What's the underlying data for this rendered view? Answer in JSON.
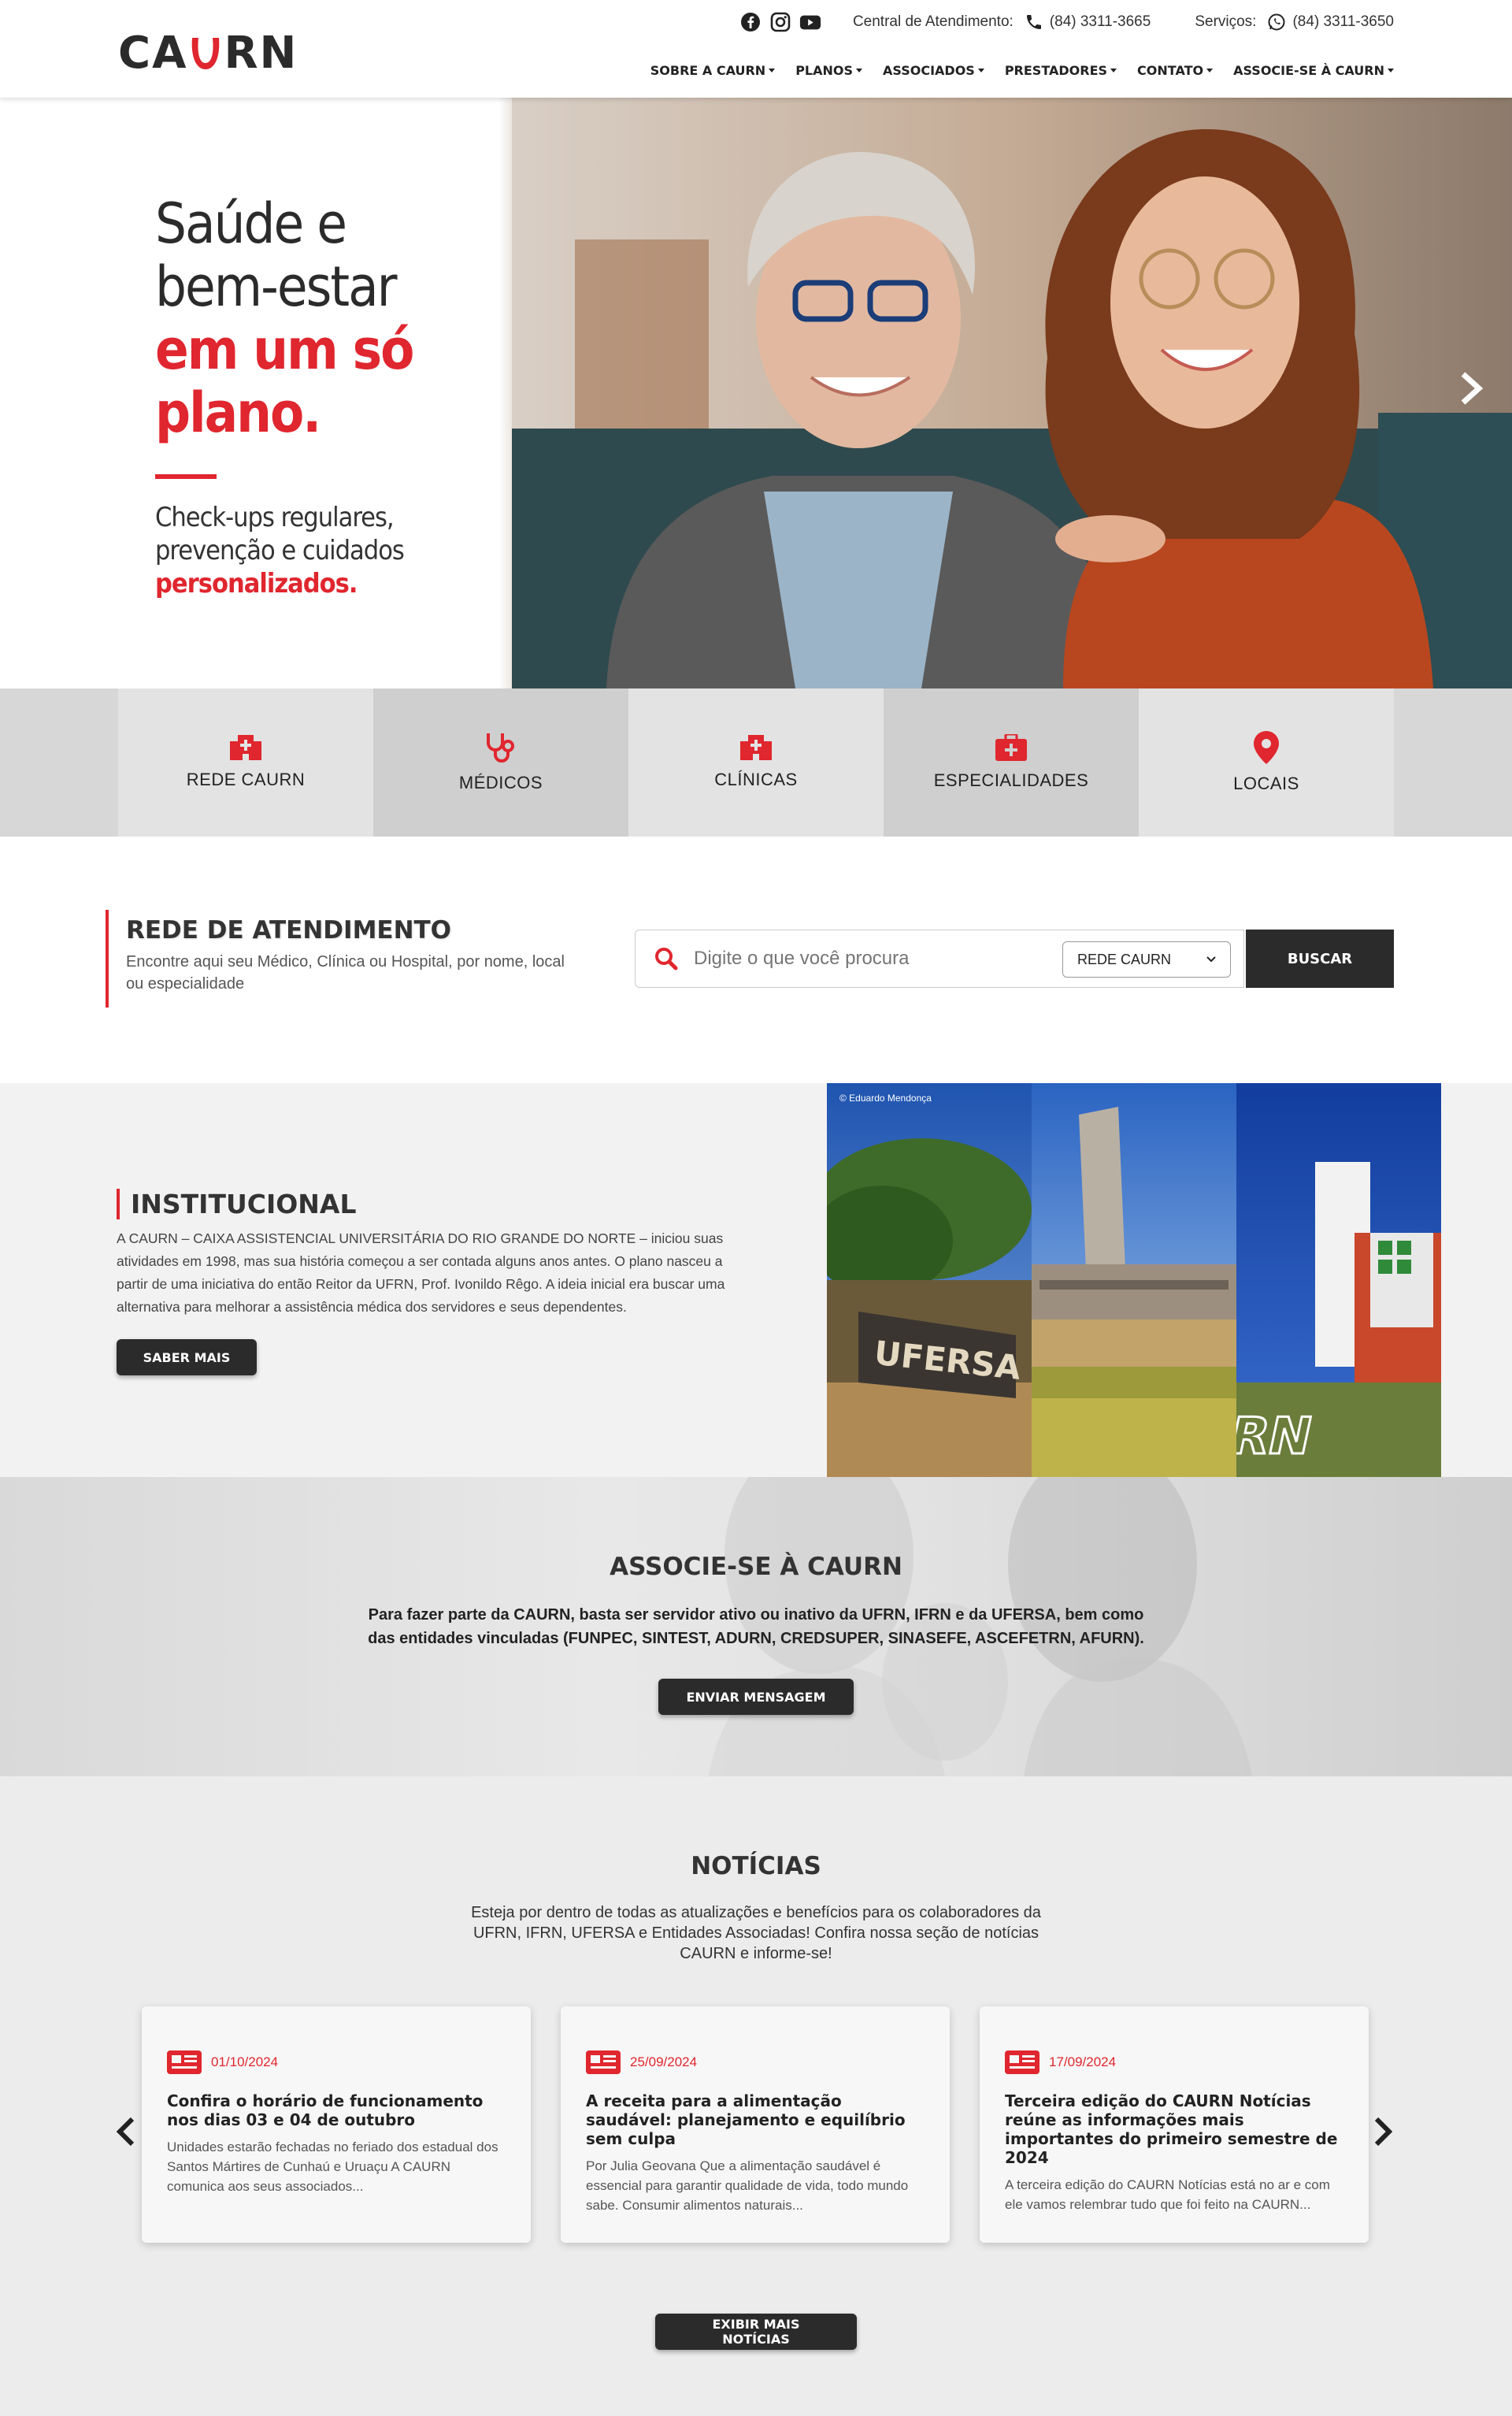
{
  "header": {
    "logo": "CAURN",
    "central_label": "Central de Atendimento:",
    "central_phone": "(84) 3311-3665",
    "servicos_label": "Serviços:",
    "servicos_phone": "(84) 3311-3650",
    "social": [
      "facebook-icon",
      "instagram-icon",
      "youtube-icon"
    ],
    "nav": [
      "SOBRE A CAURN",
      "PLANOS",
      "ASSOCIADOS",
      "PRESTADORES",
      "CONTATO",
      "ASSOCIE-SE À CAURN"
    ]
  },
  "hero": {
    "line1": "Saúde e",
    "line2": "bem-estar",
    "line3": "em um só",
    "line4": "plano.",
    "sub1": "Check-ups regulares,",
    "sub2": "prevenção e cuidados",
    "sub3": "personalizados.",
    "next_icon": "chevron-right-icon"
  },
  "tiles": [
    {
      "label": "REDE CAURN",
      "icon": "hospital-icon"
    },
    {
      "label": "MÉDICOS",
      "icon": "stethoscope-icon"
    },
    {
      "label": "CLÍNICAS",
      "icon": "hospital-icon"
    },
    {
      "label": "ESPECIALIDADES",
      "icon": "medkit-icon"
    },
    {
      "label": "LOCAIS",
      "icon": "map-pin-icon"
    }
  ],
  "rede": {
    "title": "REDE DE ATENDIMENTO",
    "desc": "Encontre aqui seu Médico, Clínica ou Hospital, por nome, local ou especialidade",
    "placeholder": "Digite o que você procura",
    "select": "REDE CAURN",
    "button": "BUSCAR"
  },
  "inst": {
    "title": "INSTITUCIONAL",
    "text": "A CAURN – CAIXA ASSISTENCIAL UNIVERSITÁRIA DO RIO GRANDE DO NORTE – iniciou suas atividades em 1998, mas sua história começou a ser contada alguns anos antes. O plano nasceu a partir de uma iniciativa do então Reitor da UFRN, Prof. Ivonildo Rêgo. A ideia inicial era buscar uma alternativa para melhorar a assistência médica dos servidores e seus dependentes.",
    "button": "SABER MAIS",
    "credit": "© Eduardo Mendonça",
    "sign1": "UFERSA",
    "sign3": "IFRN"
  },
  "assoc": {
    "title": "ASSOCIE-SE À CAURN",
    "text": "Para fazer parte da CAURN, basta ser servidor ativo ou inativo da UFRN, IFRN e da UFERSA, bem como das entidades vinculadas (FUNPEC, SINTEST, ADURN, CREDSUPER, SINASEFE, ASCEFETRN, AFURN).",
    "button": "ENVIAR MENSAGEM"
  },
  "news": {
    "title": "NOTÍCIAS",
    "intro": "Esteja por dentro de todas as atualizações e benefícios para os colaboradores da UFRN, IFRN, UFERSA e Entidades Associadas! Confira nossa seção de notícias CAURN e informe-se!",
    "cards": [
      {
        "date": "01/10/2024",
        "title": "Confira o horário de funcionamento nos dias 03 e 04 de outubro",
        "excerpt": "Unidades estarão fechadas no feriado dos estadual dos Santos Mártires de Cunhaú e Uruaçu A CAURN comunica aos seus associados..."
      },
      {
        "date": "25/09/2024",
        "title": "A receita para a alimentação saudável: planejamento e equilíbrio sem culpa",
        "excerpt": "Por Julia Geovana Que a alimentação saudável é essencial para garantir qualidade de vida, todo mundo sabe. Consumir alimentos naturais..."
      },
      {
        "date": "17/09/2024",
        "title": "Terceira edição do CAURN Notícias reúne as informações mais importantes do primeiro semestre de 2024",
        "excerpt": "A terceira edição do CAURN Notícias está no ar e com ele vamos relembrar tudo que foi feito na CAURN..."
      }
    ],
    "button": "EXIBIR MAIS NOTÍCIAS"
  },
  "colors": {
    "accent": "#e0262e",
    "dark": "#2b2b2b"
  }
}
